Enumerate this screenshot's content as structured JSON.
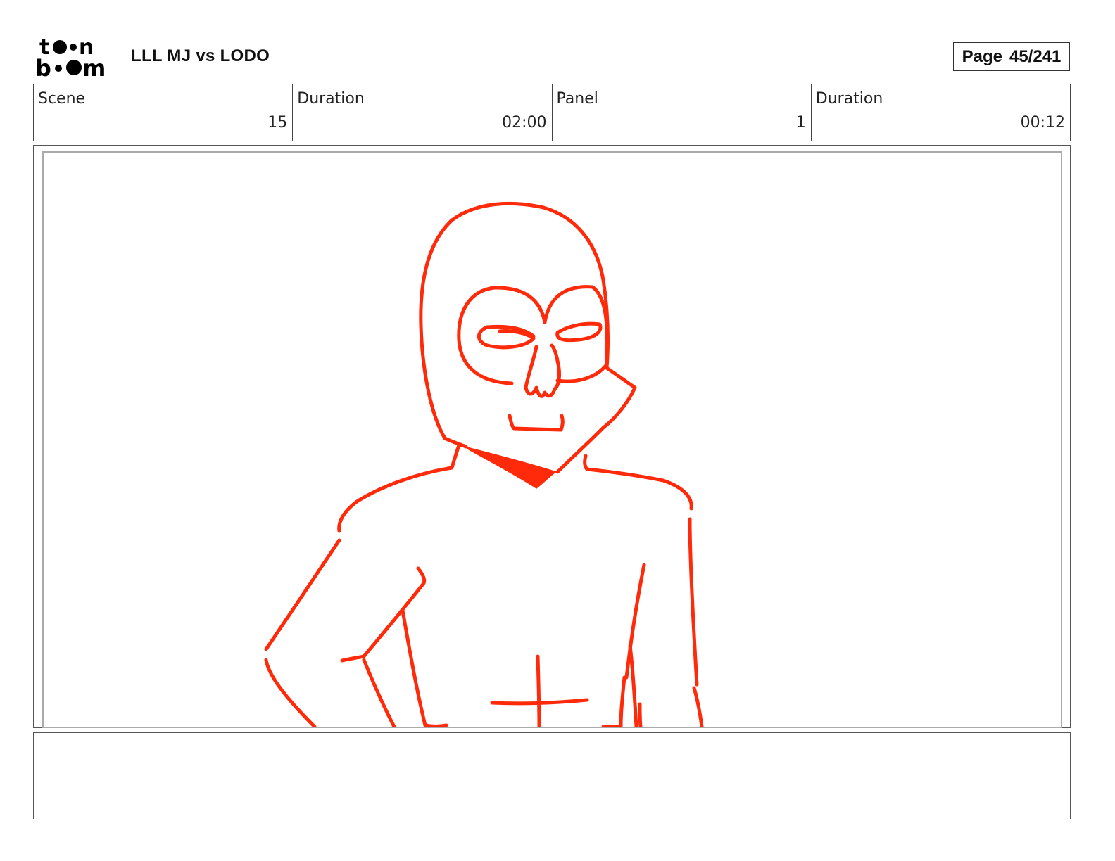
{
  "logo": {
    "name": "toon boom",
    "line1": "t  n",
    "line2": "b  m"
  },
  "header": {
    "title": "LLL MJ vs LODO",
    "page_label": "Page",
    "page_number": "45/241"
  },
  "info": {
    "scene_label": "Scene",
    "scene_value": "15",
    "scene_duration_label": "Duration",
    "scene_duration_value": "02:00",
    "panel_label": "Panel",
    "panel_value": "1",
    "panel_duration_label": "Duration",
    "panel_duration_value": "00:12"
  },
  "panel": {
    "sketch_color": "#ff2a0a",
    "subject": "red line sketch of a masked figure with a skull face"
  },
  "caption": {
    "text": ""
  }
}
